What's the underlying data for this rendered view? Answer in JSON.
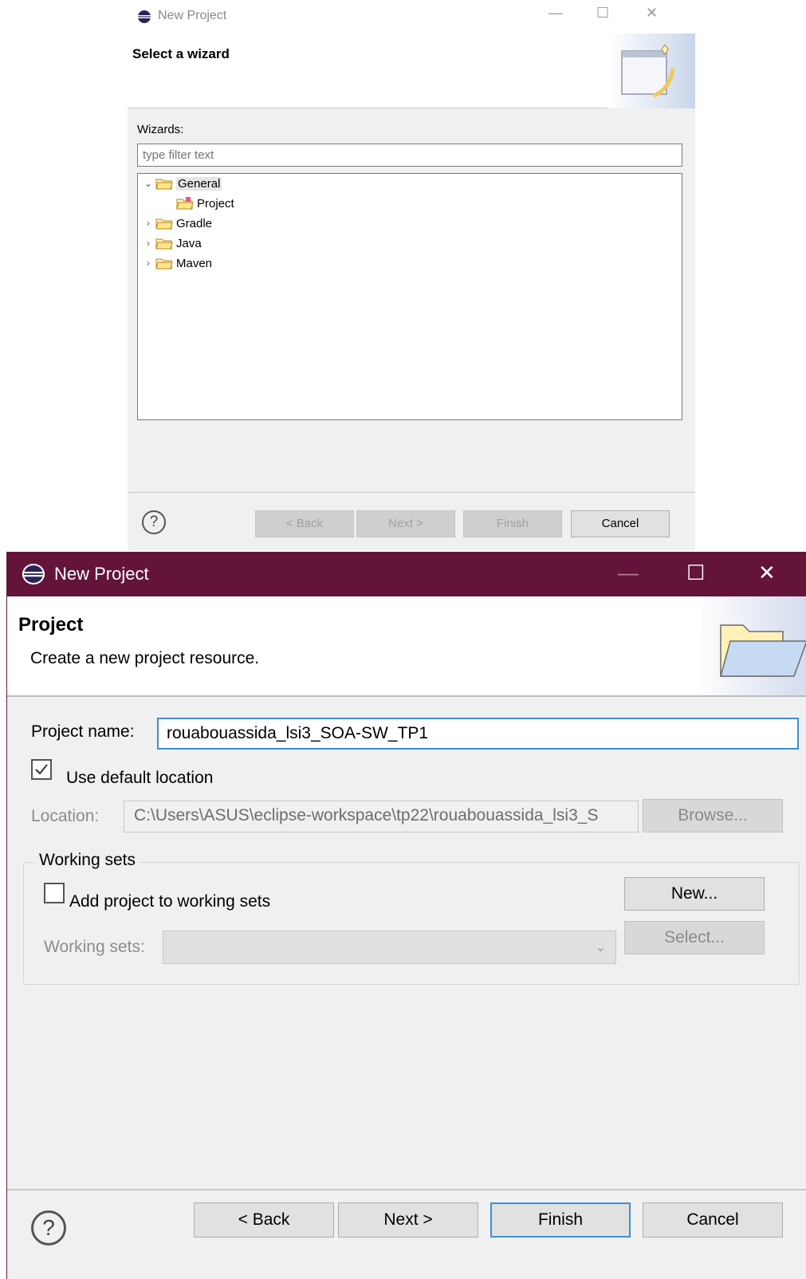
{
  "dialog1": {
    "window_title": "New Project",
    "header_title": "Select a wizard",
    "wizards_label": "Wizards:",
    "filter_placeholder": "type filter text",
    "tree": [
      {
        "label": "General",
        "expanded": true,
        "selected": true,
        "icon": "folder-open-icon"
      },
      {
        "label": "Project",
        "child": true,
        "icon": "project-icon"
      },
      {
        "label": "Gradle",
        "expanded": false,
        "icon": "folder-icon"
      },
      {
        "label": "Java",
        "expanded": false,
        "icon": "folder-icon"
      },
      {
        "label": "Maven",
        "expanded": false,
        "icon": "folder-icon"
      }
    ],
    "buttons": {
      "back": "< Back",
      "next": "Next >",
      "finish": "Finish",
      "cancel": "Cancel"
    },
    "help": "?",
    "controls": {
      "minimize": "—",
      "maximize": "☐",
      "close": "✕"
    }
  },
  "dialog2": {
    "window_title": "New Project",
    "header_title": "Project",
    "header_description": "Create a new project resource.",
    "project_name_label": "Project name:",
    "project_name_value": "rouabouassida_lsi3_SOA-SW_TP1",
    "use_default_location_label": "Use default location",
    "use_default_location_checked": true,
    "location_label": "Location:",
    "location_value": "C:\\Users\\ASUS\\eclipse-workspace\\tp22\\rouabouassida_lsi3_S",
    "browse_button": "Browse...",
    "working_sets_group": "Working sets",
    "add_to_working_sets_label": "Add project to working sets",
    "add_to_working_sets_checked": false,
    "new_button": "New...",
    "working_sets_label": "Working sets:",
    "select_button": "Select...",
    "buttons": {
      "back": "< Back",
      "next": "Next >",
      "finish": "Finish",
      "cancel": "Cancel"
    },
    "help": "?",
    "controls": {
      "minimize": "—",
      "maximize": "☐",
      "close": "✕"
    }
  },
  "colors": {
    "titlebar_active": "#641438",
    "focus_border": "#3d8fd9",
    "dialog_bg": "#f0f0f0"
  }
}
